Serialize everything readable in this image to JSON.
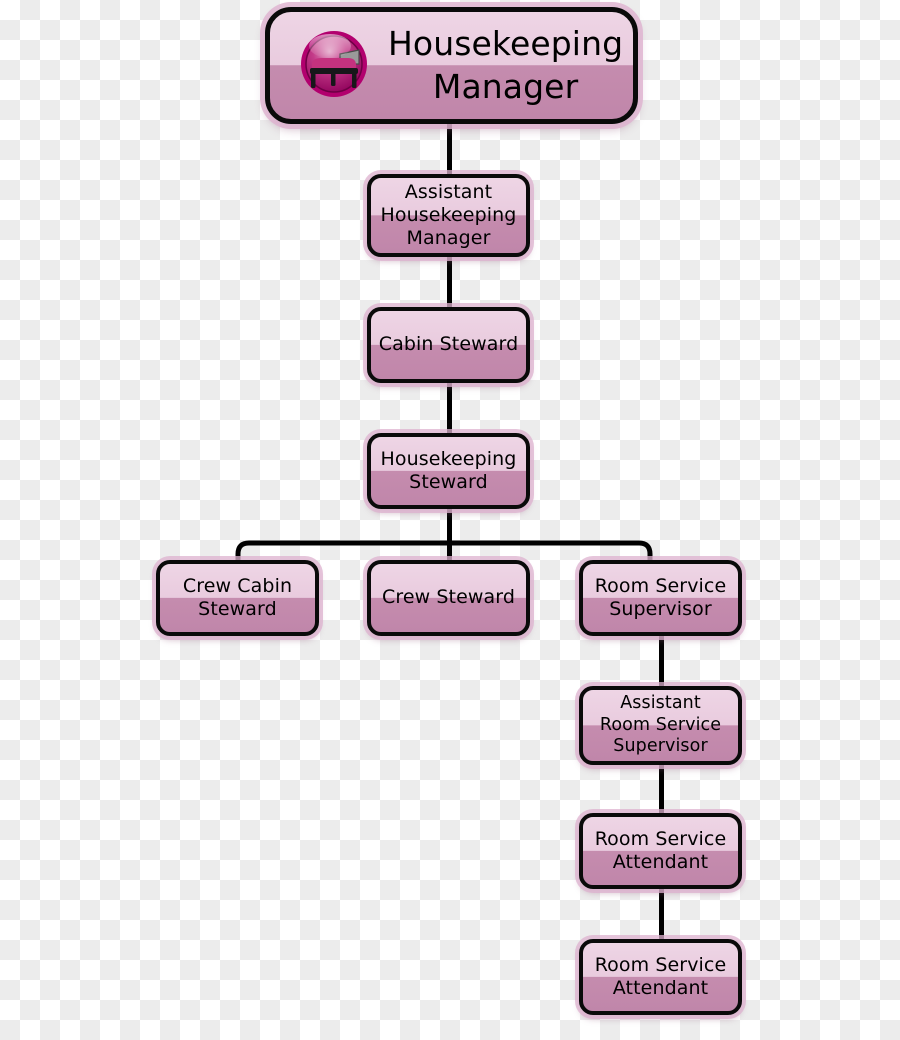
{
  "chart_data": {
    "type": "diagram",
    "subtype": "organizational-chart",
    "title": "Housekeeping Manager",
    "orientation": "top-down",
    "colors": {
      "box_top": "#e9cbde",
      "box_bottom": "#c086aa",
      "box_border": "#0a0a0a",
      "box_glow": "#deb2cf",
      "connector": "#000000",
      "icon_badge": "#b2006e",
      "text": "#000000",
      "canvas_checker_light": "#ffffff",
      "canvas_checker_dark": "#ececec"
    },
    "nodes": [
      {
        "id": "housekeeping-manager",
        "label": "Housekeeping Manager",
        "level": 0,
        "lines": [
          "Housekeeping",
          "Manager"
        ],
        "icon": "bed-icon"
      },
      {
        "id": "assistant-housekeeping-manager",
        "label": "Assistant Housekeeping Manager",
        "level": 1,
        "lines": [
          "Assistant",
          "Housekeeping",
          "Manager"
        ]
      },
      {
        "id": "cabin-steward",
        "label": "Cabin Steward",
        "level": 2,
        "lines": [
          "Cabin Steward"
        ]
      },
      {
        "id": "housekeeping-steward",
        "label": "Housekeeping Steward",
        "level": 3,
        "lines": [
          "Housekeeping",
          "Steward"
        ]
      },
      {
        "id": "crew-cabin-steward",
        "label": "Crew Cabin Steward",
        "level": 4,
        "lines": [
          "Crew Cabin",
          "Steward"
        ]
      },
      {
        "id": "crew-steward",
        "label": "Crew Steward",
        "level": 4,
        "lines": [
          "Crew Steward"
        ]
      },
      {
        "id": "room-service-supervisor",
        "label": "Room Service Supervisor",
        "level": 4,
        "lines": [
          "Room Service",
          "Supervisor"
        ]
      },
      {
        "id": "assistant-room-service-supervisor",
        "label": "Assistant Room Service Supervisor",
        "level": 5,
        "lines": [
          "Assistant",
          "Room Service",
          "Supervisor"
        ]
      },
      {
        "id": "room-service-attendant-1",
        "label": "Room Service Attendant",
        "level": 6,
        "lines": [
          "Room Service",
          "Attendant"
        ]
      },
      {
        "id": "room-service-attendant-2",
        "label": "Room Service Attendant",
        "level": 7,
        "lines": [
          "Room Service",
          "Attendant"
        ]
      }
    ],
    "edges": [
      {
        "from": "housekeeping-manager",
        "to": "assistant-housekeeping-manager"
      },
      {
        "from": "assistant-housekeeping-manager",
        "to": "cabin-steward"
      },
      {
        "from": "cabin-steward",
        "to": "housekeeping-steward"
      },
      {
        "from": "housekeeping-steward",
        "to": "crew-cabin-steward"
      },
      {
        "from": "housekeeping-steward",
        "to": "crew-steward"
      },
      {
        "from": "housekeeping-steward",
        "to": "room-service-supervisor"
      },
      {
        "from": "room-service-supervisor",
        "to": "assistant-room-service-supervisor"
      },
      {
        "from": "assistant-room-service-supervisor",
        "to": "room-service-attendant-1"
      },
      {
        "from": "room-service-attendant-1",
        "to": "room-service-attendant-2"
      }
    ]
  },
  "root": {
    "line1": "Housekeeping",
    "line2": "Manager",
    "icon": "bed-icon"
  },
  "n1": {
    "line1": "Assistant",
    "line2": "Housekeeping",
    "line3": "Manager"
  },
  "n2": {
    "line1": "Cabin Steward"
  },
  "n3": {
    "line1": "Housekeeping",
    "line2": "Steward"
  },
  "n4": {
    "line1": "Crew Cabin",
    "line2": "Steward"
  },
  "n5": {
    "line1": "Crew Steward"
  },
  "n6": {
    "line1": "Room Service",
    "line2": "Supervisor"
  },
  "n7": {
    "line1": "Assistant",
    "line2": "Room Service",
    "line3": "Supervisor"
  },
  "n8": {
    "line1": "Room Service",
    "line2": "Attendant"
  },
  "n9": {
    "line1": "Room Service",
    "line2": "Attendant"
  }
}
